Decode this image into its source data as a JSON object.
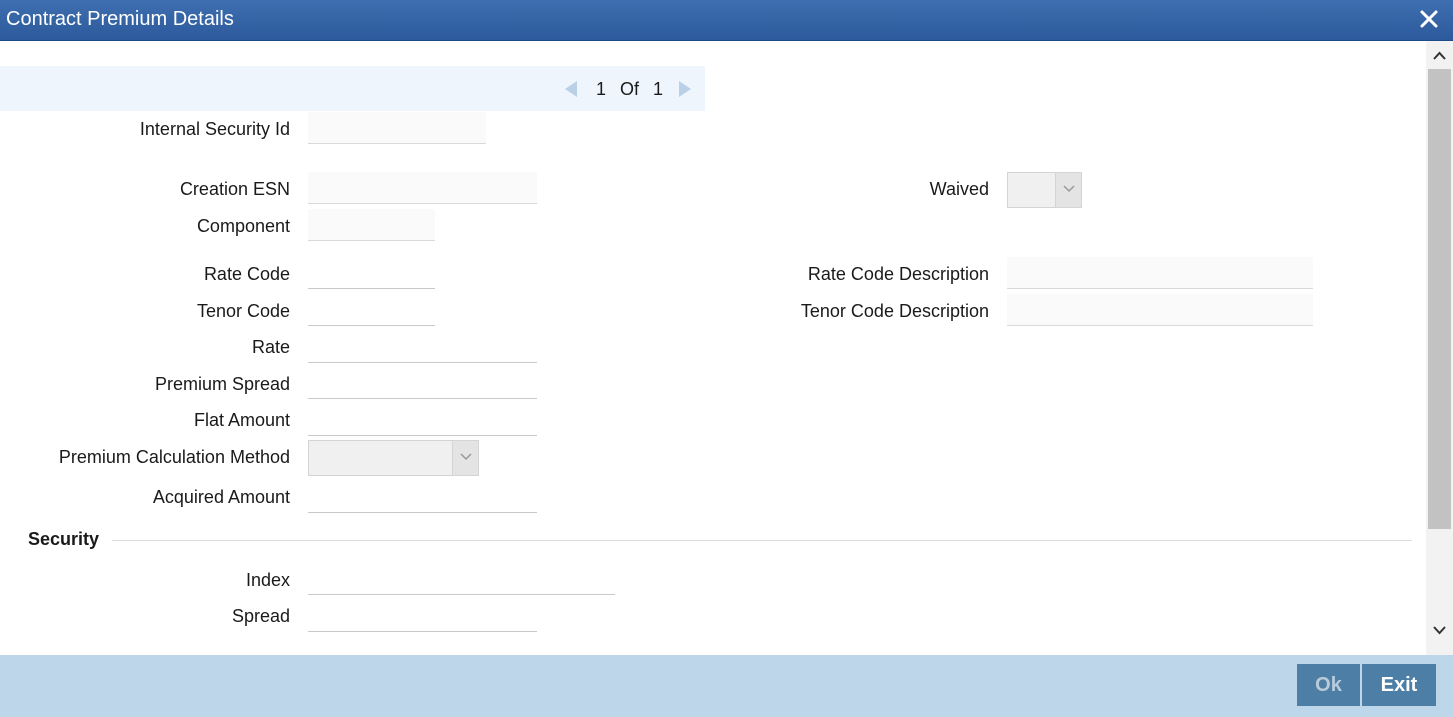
{
  "window": {
    "title": "Contract Premium Details",
    "close_icon": "close-icon"
  },
  "pager": {
    "current": "1",
    "of_label": "Of",
    "total": "1"
  },
  "fields": {
    "internal_security_id": {
      "label": "Internal Security Id",
      "value": ""
    },
    "creation_esn": {
      "label": "Creation ESN",
      "value": ""
    },
    "component": {
      "label": "Component",
      "value": ""
    },
    "waived": {
      "label": "Waived",
      "value": ""
    },
    "rate_code": {
      "label": "Rate Code",
      "value": ""
    },
    "rate_code_description": {
      "label": "Rate Code Description",
      "value": ""
    },
    "tenor_code": {
      "label": "Tenor Code",
      "value": ""
    },
    "tenor_code_description": {
      "label": "Tenor Code Description",
      "value": ""
    },
    "rate": {
      "label": "Rate",
      "value": ""
    },
    "premium_spread": {
      "label": "Premium Spread",
      "value": ""
    },
    "flat_amount": {
      "label": "Flat Amount",
      "value": ""
    },
    "premium_calculation_method": {
      "label": "Premium Calculation Method",
      "value": ""
    },
    "acquired_amount": {
      "label": "Acquired Amount",
      "value": ""
    }
  },
  "security_section": {
    "title": "Security",
    "index": {
      "label": "Index",
      "value": ""
    },
    "spread": {
      "label": "Spread",
      "value": ""
    }
  },
  "footer": {
    "ok_label": "Ok",
    "exit_label": "Exit"
  },
  "colors": {
    "titlebar": "#2c5a9c",
    "footer": "#bed6ea",
    "button": "#4d7fa6",
    "pager_bg": "#eef5fc"
  }
}
